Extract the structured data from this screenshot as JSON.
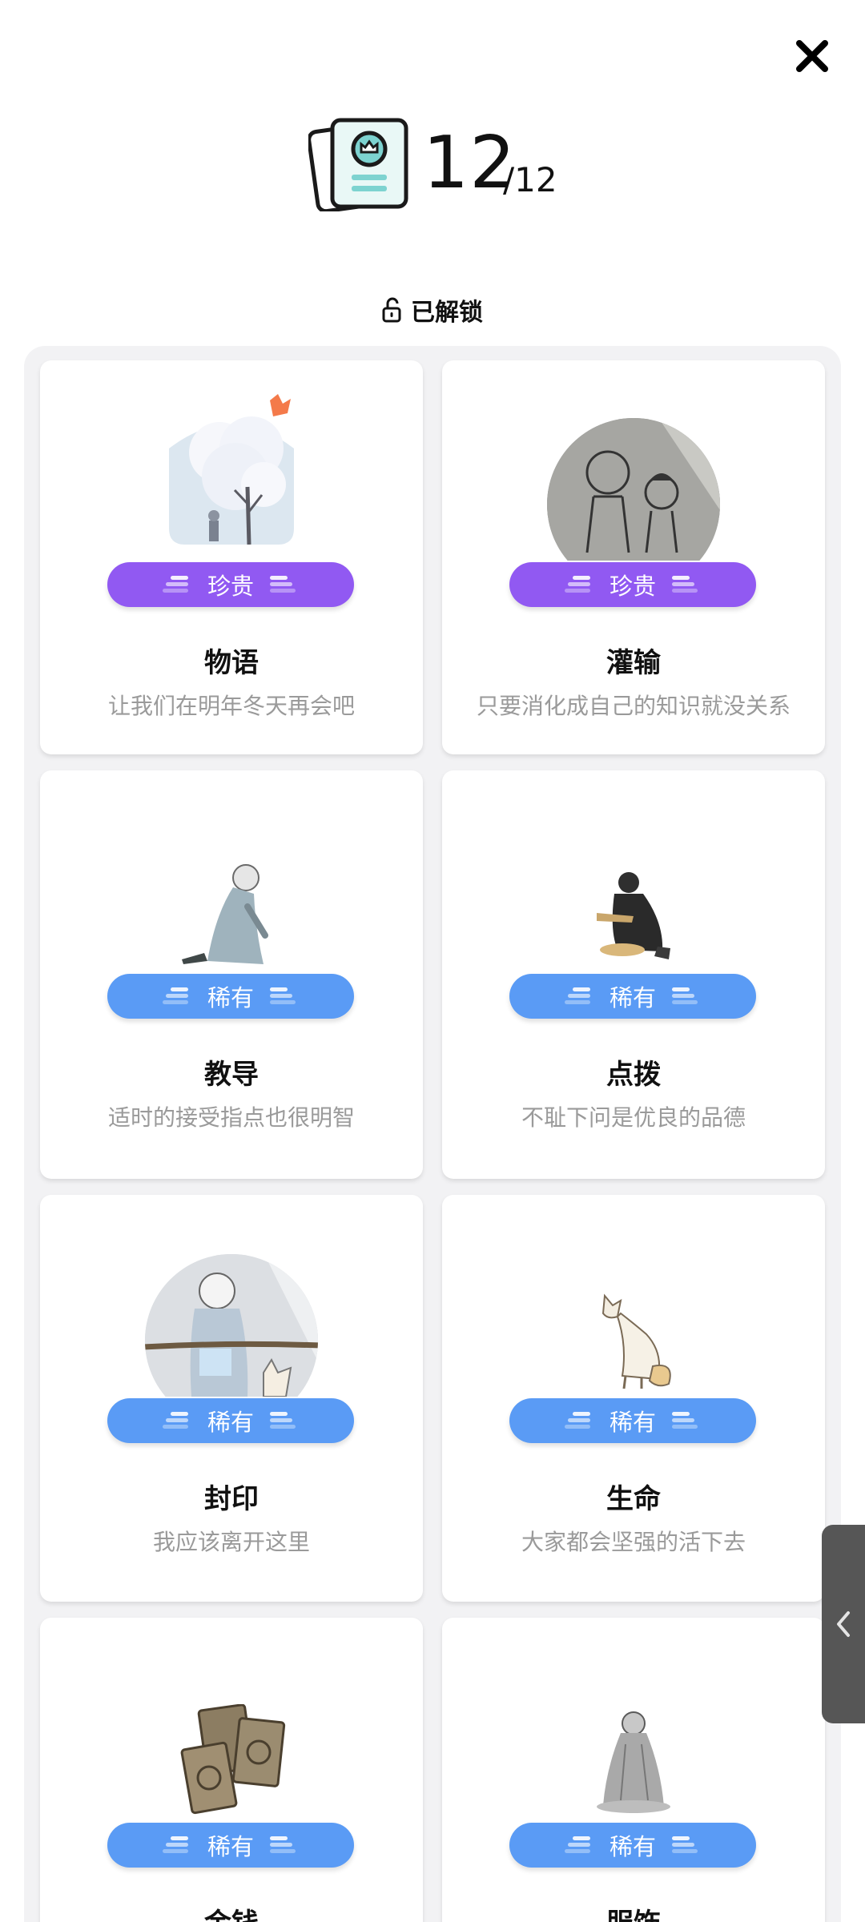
{
  "close_icon": "close-icon",
  "header": {
    "icon": "card-collection-icon",
    "count": "12",
    "total": "/12"
  },
  "status": {
    "icon": "unlock-icon",
    "label": "已解锁"
  },
  "cards": [
    {
      "title": "物语",
      "desc": "让我们在明年冬天再会吧",
      "rarity": "珍贵",
      "art": "snow-tree-illustration"
    },
    {
      "title": "灌输",
      "desc": "只要消化成自己的知识就没关系",
      "rarity": "珍贵",
      "art": "children-sketch-illustration"
    },
    {
      "title": "教导",
      "desc": "适时的接受指点也很明智",
      "rarity": "稀有",
      "art": "kneeling-figure-illustration"
    },
    {
      "title": "点拨",
      "desc": "不耻下问是优良的品德",
      "rarity": "稀有",
      "art": "sitting-figure-illustration"
    },
    {
      "title": "封印",
      "desc": "我应该离开这里",
      "rarity": "稀有",
      "art": "seal-scene-illustration"
    },
    {
      "title": "生命",
      "desc": "大家都会坚强的活下去",
      "rarity": "稀有",
      "art": "fox-illustration"
    },
    {
      "title": "金钱",
      "desc": "",
      "rarity": "稀有",
      "art": "coins-illustration"
    },
    {
      "title": "服饰",
      "desc": "",
      "rarity": "稀有",
      "art": "robed-figure-illustration"
    }
  ],
  "side_handle_icon": "chevron-left-icon",
  "colors": {
    "precious_badge": "#9159f2",
    "rare_badge": "#5a9bf5",
    "panel_bg": "#f2f2f4",
    "crown_accent": "#f47a4a"
  }
}
